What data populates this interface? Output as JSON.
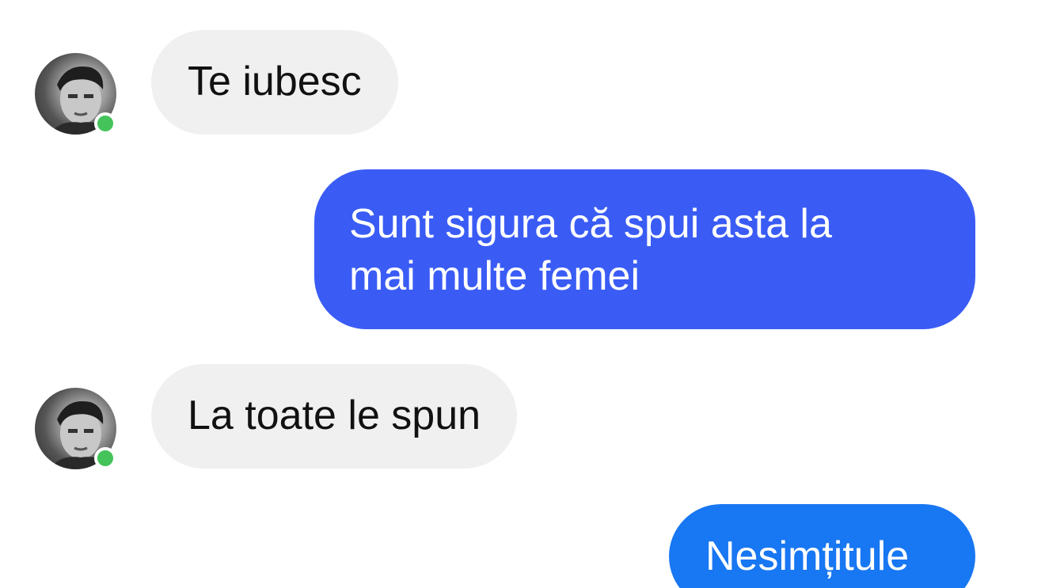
{
  "conversation": {
    "colors": {
      "incoming_bubble": "#f0f0f0",
      "outgoing_bubble_1": "#3a5cf5",
      "outgoing_bubble_2": "#1877f2",
      "presence": "#44c35a"
    },
    "messages": [
      {
        "direction": "incoming",
        "text": "Te iubesc"
      },
      {
        "direction": "outgoing",
        "text": "Sunt sigura că spui asta la\nmai multe femei"
      },
      {
        "direction": "incoming",
        "text": "La toate le spun"
      },
      {
        "direction": "outgoing",
        "text": "Nesimțitule"
      }
    ],
    "sender_avatar": {
      "icon": "avatar-photo",
      "status": "online"
    }
  }
}
